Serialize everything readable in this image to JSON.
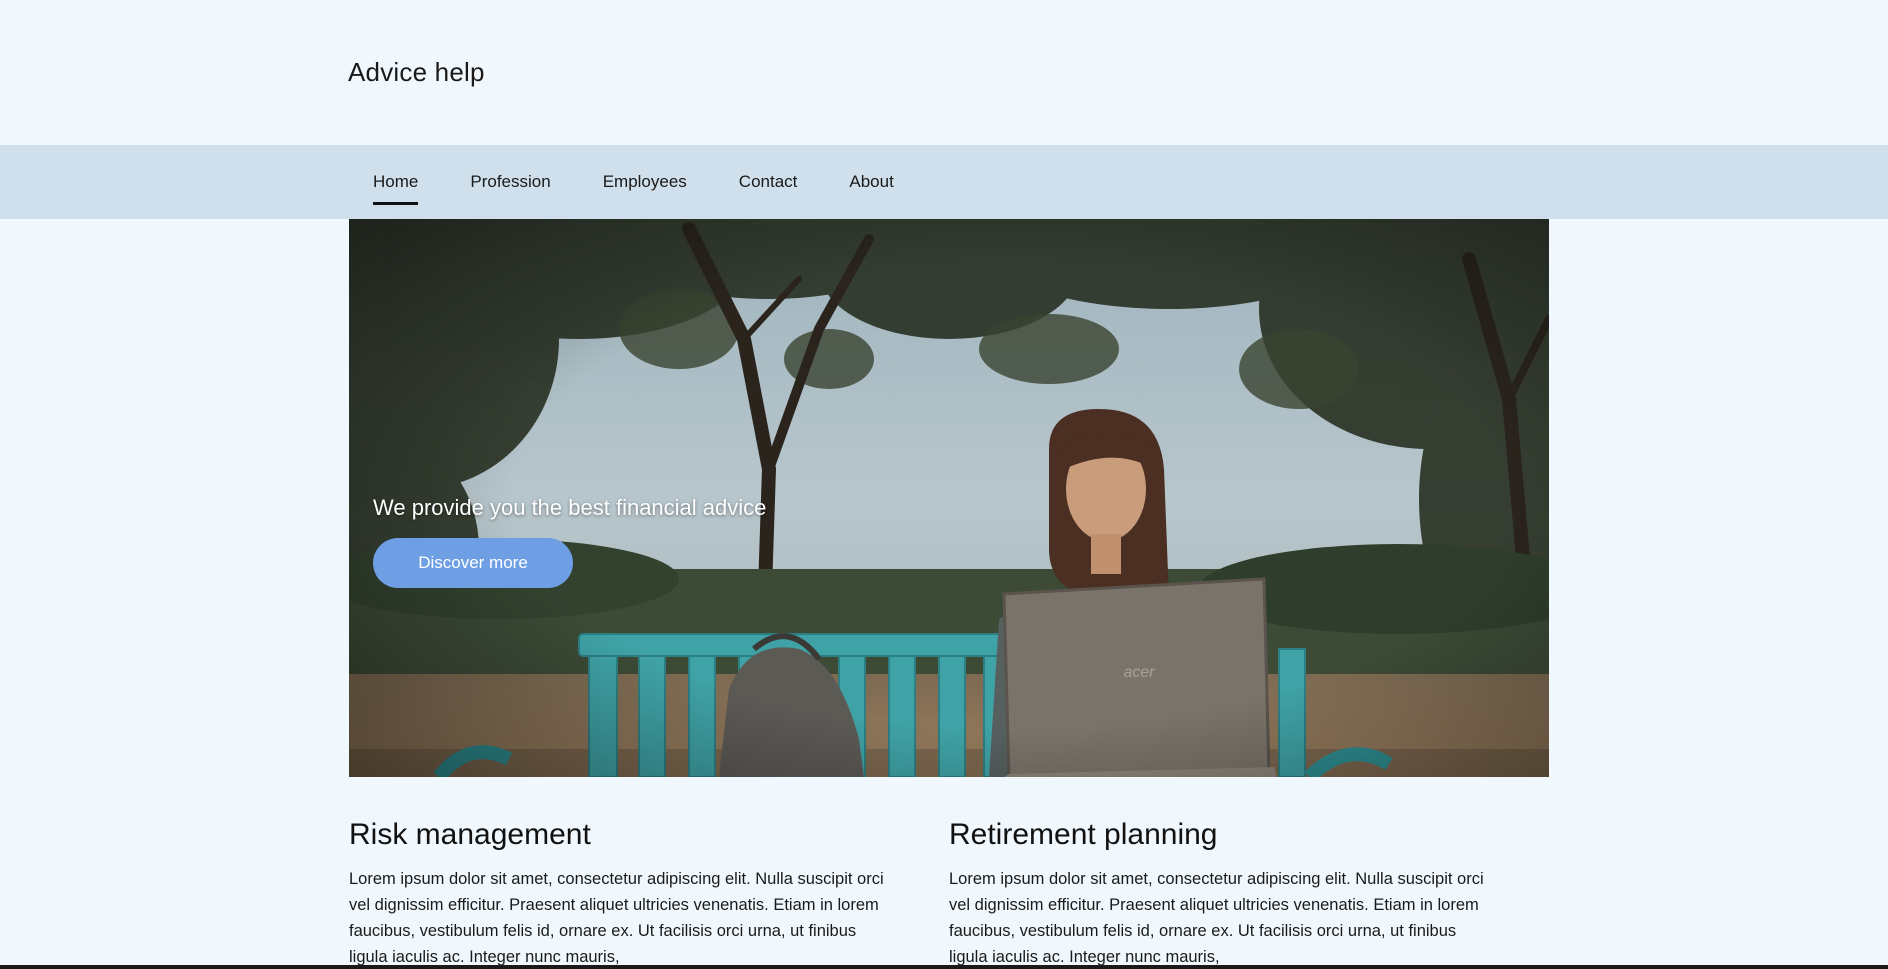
{
  "site": {
    "title": "Advice help"
  },
  "nav": {
    "items": [
      {
        "label": "Home",
        "active": true
      },
      {
        "label": "Profession",
        "active": false
      },
      {
        "label": "Employees",
        "active": false
      },
      {
        "label": "Contact",
        "active": false
      },
      {
        "label": "About",
        "active": false
      }
    ]
  },
  "hero": {
    "heading": "We provide you the best financial advice",
    "button_label": "Discover more",
    "laptop_brand": "acer"
  },
  "sections": [
    {
      "title": "Risk management",
      "body": "Lorem ipsum dolor sit amet, consectetur adipiscing elit. Nulla suscipit orci vel dignissim efficitur. Praesent aliquet ultricies venenatis. Etiam in lorem faucibus, vestibulum felis id, ornare ex. Ut facilisis orci urna, ut finibus ligula iaculis ac. Integer nunc mauris,"
    },
    {
      "title": "Retirement planning",
      "body": "Lorem ipsum dolor sit amet, consectetur adipiscing elit. Nulla suscipit orci vel dignissim efficitur. Praesent aliquet ultricies venenatis. Etiam in lorem faucibus, vestibulum felis id, ornare ex. Ut facilisis orci urna, ut finibus ligula iaculis ac. Integer nunc mauris,"
    }
  ],
  "colors": {
    "page_background": "#f0f8fd",
    "nav_background": "#cfe0ec",
    "button": "#6e9ee4"
  }
}
